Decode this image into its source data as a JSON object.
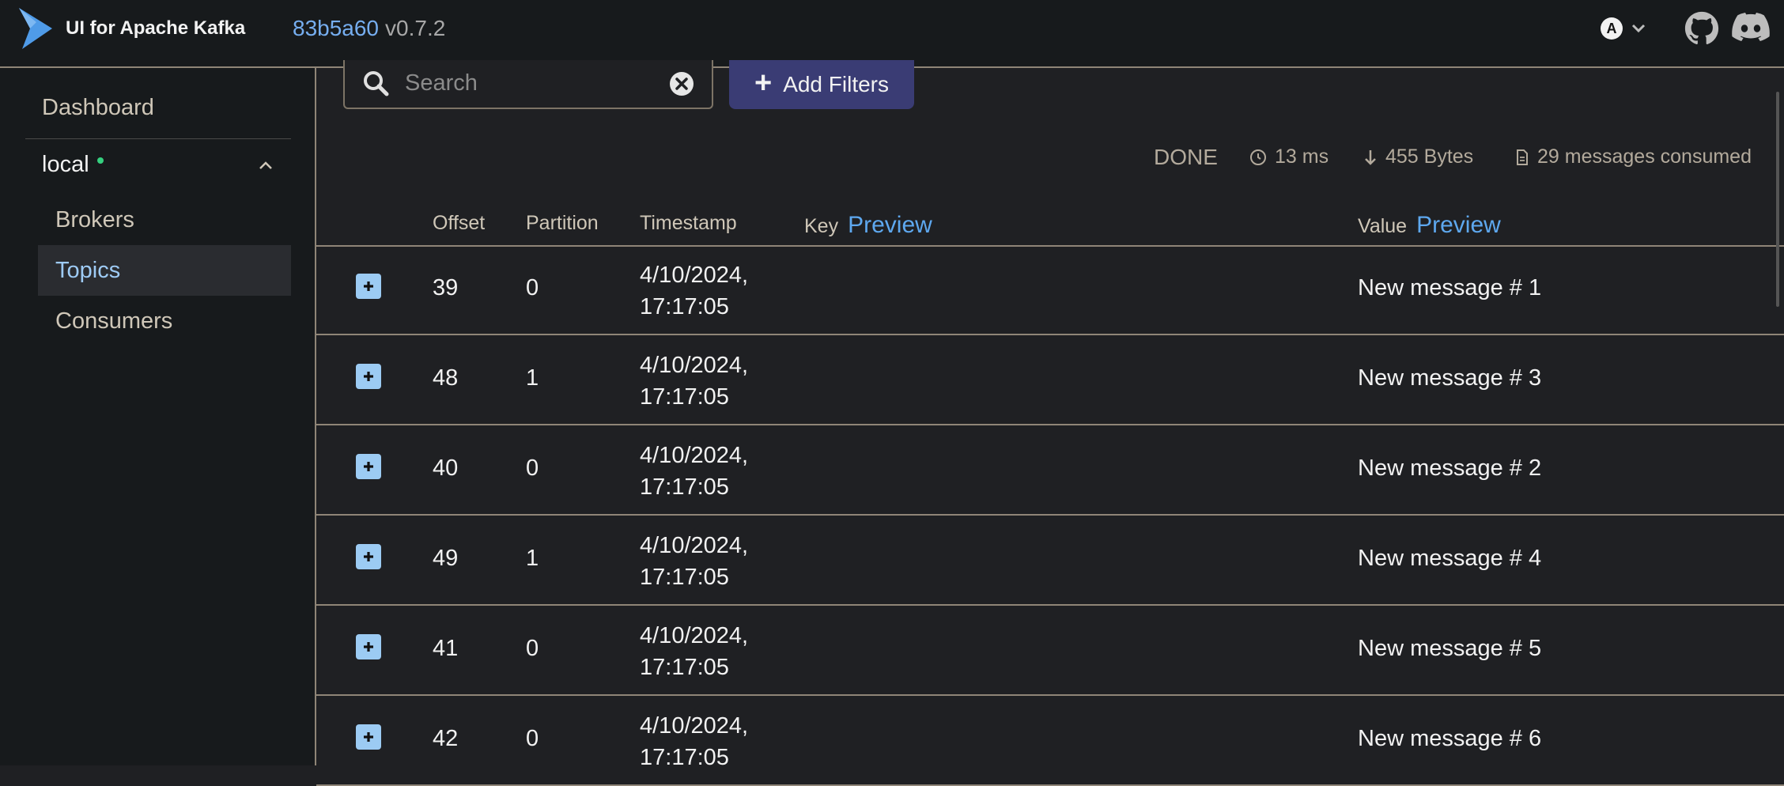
{
  "header": {
    "app_title": "UI for Apache Kafka",
    "commit": "83b5a60",
    "version": "v0.7.2",
    "user_initial": "A",
    "icons": [
      "kafka-logo-icon",
      "chevron-down-icon",
      "github-icon",
      "discord-icon"
    ]
  },
  "sidebar": {
    "dashboard": "Dashboard",
    "cluster": "local",
    "items": [
      {
        "label": "Brokers",
        "active": false
      },
      {
        "label": "Topics",
        "active": true
      },
      {
        "label": "Consumers",
        "active": false
      }
    ]
  },
  "toolbar": {
    "search_placeholder": "Search",
    "add_filters": "Add Filters"
  },
  "status": {
    "state": "DONE",
    "time": "13 ms",
    "bytes": "455 Bytes",
    "messages": "29 messages consumed"
  },
  "table": {
    "columns": {
      "offset": "Offset",
      "partition": "Partition",
      "timestamp": "Timestamp",
      "key": "Key",
      "value": "Value",
      "preview": "Preview"
    },
    "rows": [
      {
        "offset": "39",
        "partition": "0",
        "date": "4/10/2024,",
        "time": "17:17:05",
        "value": "New message # 1"
      },
      {
        "offset": "48",
        "partition": "1",
        "date": "4/10/2024,",
        "time": "17:17:05",
        "value": "New message # 3"
      },
      {
        "offset": "40",
        "partition": "0",
        "date": "4/10/2024,",
        "time": "17:17:05",
        "value": "New message # 2"
      },
      {
        "offset": "49",
        "partition": "1",
        "date": "4/10/2024,",
        "time": "17:17:05",
        "value": "New message # 4"
      },
      {
        "offset": "41",
        "partition": "0",
        "date": "4/10/2024,",
        "time": "17:17:05",
        "value": "New message # 5"
      },
      {
        "offset": "42",
        "partition": "0",
        "date": "4/10/2024,",
        "time": "17:17:05",
        "value": "New message # 6"
      }
    ]
  },
  "colors": {
    "background": "#1f2023",
    "sidebar": "#171a1c",
    "accent": "#5ea8ef",
    "button": "#3a3c74",
    "status_dot": "#35d07f",
    "divider": "#8f8577"
  }
}
